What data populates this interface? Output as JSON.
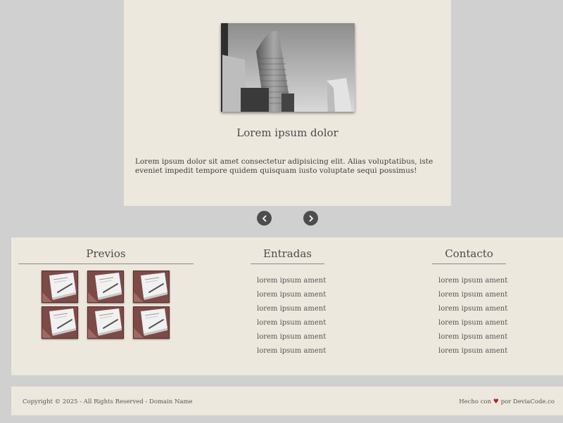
{
  "slider": {
    "image_alt": "skyscraper-photo",
    "title": "Lorem ipsum dolor",
    "text": "Lorem ipsum dolor sit amet consectetur adipisicing elit. Alias voluptatibus, iste eveniet impedit tempore quidem quisquam iusto voluptate sequi possimus!",
    "prev_icon": "chevron-left-icon",
    "next_icon": "chevron-right-icon"
  },
  "footer": {
    "previos": {
      "title": "Previos",
      "thumb_count": 6
    },
    "entradas": {
      "title": "Entradas",
      "links": [
        "lorem ipsum ament",
        "lorem ipsum ament",
        "lorem ipsum ament",
        "lorem ipsum ament",
        "lorem ipsum ament",
        "lorem ipsum ament"
      ]
    },
    "contacto": {
      "title": "Contacto",
      "links": [
        "lorem ipsum ament",
        "lorem ipsum ament",
        "lorem ipsum ament",
        "lorem ipsum ament",
        "lorem ipsum ament",
        "lorem ipsum ament"
      ]
    }
  },
  "bottom": {
    "copyright": "Copyright © 2025 - All Rights Reserved - Domain Name",
    "credit_prefix": "Hecho con",
    "credit_suffix": "por DeviaCode.co",
    "heart_icon": "heart-icon",
    "heart_color": "#b32424"
  },
  "colors": {
    "page_bg": "#d0d0d0",
    "card_bg": "#ede8de",
    "nav_button": "#4d4d4d"
  }
}
